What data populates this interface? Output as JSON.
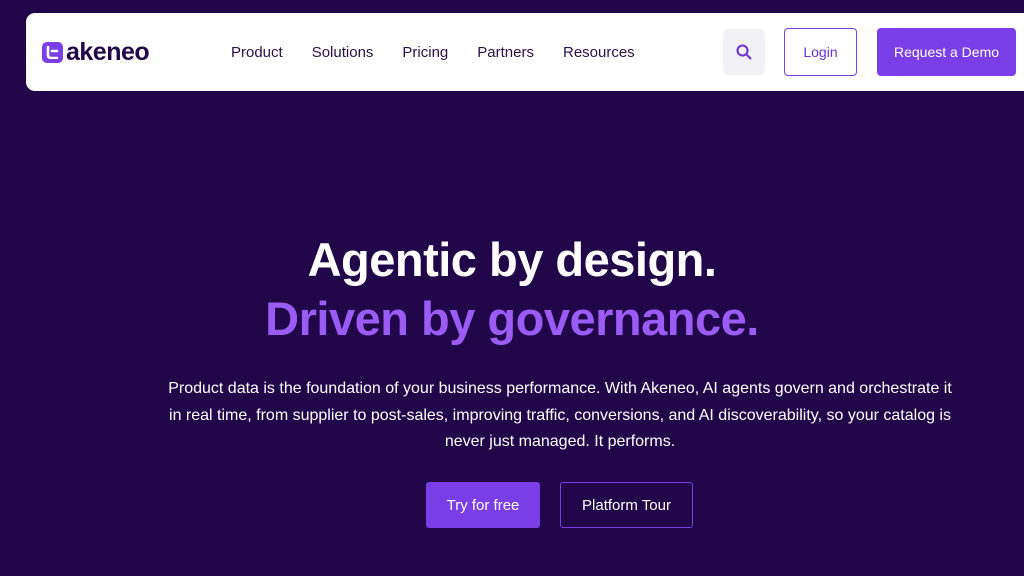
{
  "brand": {
    "name": "akeneo",
    "accent_color": "#7a3ee6",
    "background_color": "#22064a",
    "highlight_text_color": "#9b5cf6"
  },
  "nav": {
    "links": [
      "Product",
      "Solutions",
      "Pricing",
      "Partners",
      "Resources"
    ],
    "search_icon": "search-icon",
    "login_label": "Login",
    "demo_label": "Request a Demo"
  },
  "hero": {
    "title": "Agentic by design.",
    "subtitle": "Driven by governance.",
    "body_lines": [
      "Product data is the foundation of your business performance. With Akeneo, AI agents govern and orchestrate it",
      "in real time, from supplier to post-sales, improving traffic, conversions, and AI discoverability, so your catalog is",
      "never just managed. It performs."
    ],
    "primary_cta": "Try for free",
    "secondary_cta": "Platform Tour"
  }
}
